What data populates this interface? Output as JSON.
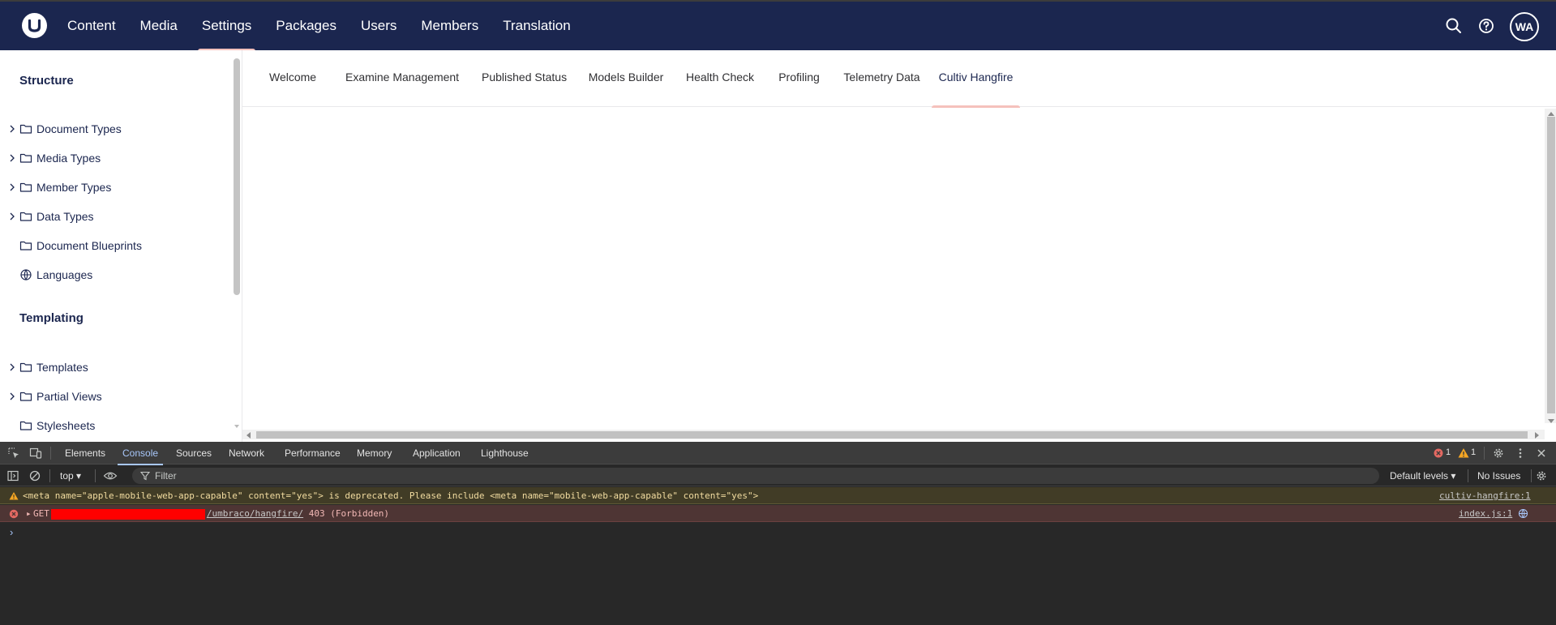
{
  "header": {
    "nav": [
      "Content",
      "Media",
      "Settings",
      "Packages",
      "Users",
      "Members",
      "Translation"
    ],
    "active_nav": "Settings",
    "avatar_initials": "WA"
  },
  "sidebar": {
    "structure_title": "Structure",
    "structure_items": [
      {
        "label": "Document Types",
        "icon": "folder-icon",
        "expandable": true
      },
      {
        "label": "Media Types",
        "icon": "folder-icon",
        "expandable": true
      },
      {
        "label": "Member Types",
        "icon": "folder-icon",
        "expandable": true
      },
      {
        "label": "Data Types",
        "icon": "folder-icon",
        "expandable": true
      },
      {
        "label": "Document Blueprints",
        "icon": "folder-icon",
        "expandable": false
      },
      {
        "label": "Languages",
        "icon": "globe-icon",
        "expandable": false
      }
    ],
    "templating_title": "Templating",
    "templating_items": [
      {
        "label": "Templates",
        "icon": "folder-icon",
        "expandable": true
      },
      {
        "label": "Partial Views",
        "icon": "folder-icon",
        "expandable": true
      },
      {
        "label": "Stylesheets",
        "icon": "folder-icon",
        "expandable": false
      }
    ]
  },
  "tabs": [
    "Welcome",
    "Examine Management",
    "Published Status",
    "Models Builder",
    "Health Check",
    "Profiling",
    "Telemetry Data",
    "Cultiv Hangfire"
  ],
  "active_tab": "Cultiv Hangfire",
  "devtools": {
    "tabs": [
      "Elements",
      "Console",
      "Sources",
      "Network",
      "Performance",
      "Memory",
      "Application",
      "Lighthouse"
    ],
    "active_tab": "Console",
    "error_count": "1",
    "warning_count": "1",
    "context": "top",
    "filter_placeholder": "Filter",
    "levels": "Default levels",
    "issues": "No Issues",
    "logs": {
      "warning_text": "<meta name=\"apple-mobile-web-app-capable\" content=\"yes\"> is deprecated. Please include <meta name=\"mobile-web-app-capable\" content=\"yes\">",
      "warning_source": "cultiv-hangfire:1",
      "error_method": "GET",
      "error_url": "/umbraco/hangfire/",
      "error_status": "403 (Forbidden)",
      "error_source": "index.js:1"
    }
  },
  "colors": {
    "header_bg": "#1b264f",
    "accent": "#f5c1bc",
    "devtools_bg": "#282828"
  }
}
